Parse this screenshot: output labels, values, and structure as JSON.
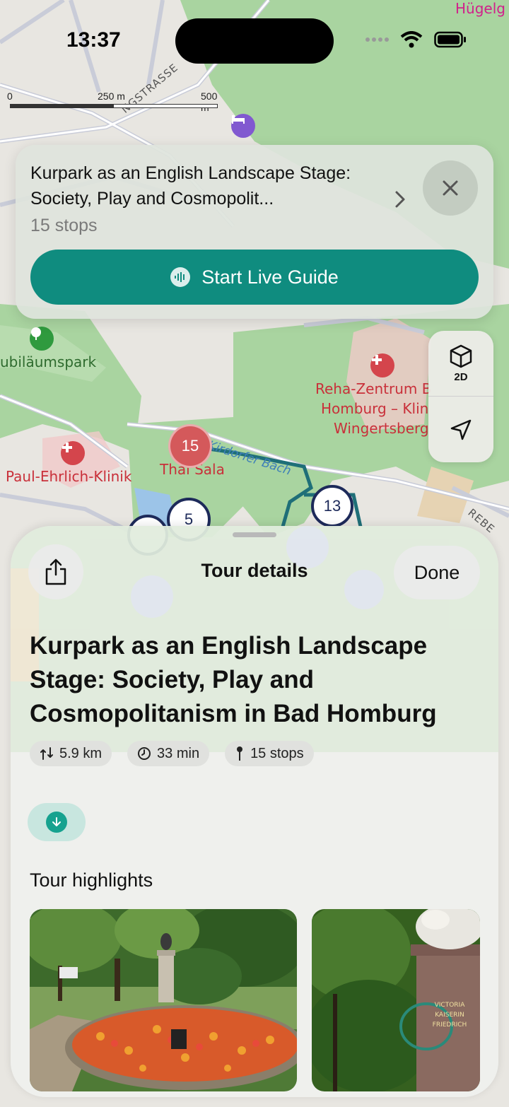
{
  "status_bar": {
    "time": "13:37"
  },
  "scale_bar": {
    "labels": [
      "0",
      "250 m",
      "500 m"
    ]
  },
  "map": {
    "labels": {
      "park": "ubiläumspark",
      "clinic": "Paul-Ehrlich-Klinik",
      "rehab_lines": [
        "Reha-Zentrum B",
        "Homburg – Klin",
        "Wingertsberg"
      ],
      "thai_sala": "Thai Sala",
      "brook": "Kirdorfer Bach",
      "street": "NGSTRASSE",
      "street_right": "REBE",
      "top_right": "Hügelg"
    },
    "markers": [
      {
        "number": "15",
        "style": "visited"
      },
      {
        "number": "13",
        "style": "default"
      },
      {
        "number": "5",
        "style": "default"
      }
    ],
    "controls": {
      "view_mode": "2D"
    }
  },
  "tour_card": {
    "title": "Kurpark as an English Landscape Stage: Society, Play and Cosmopolit...",
    "stops": "15 stops",
    "live_guide_label": "Start Live Guide"
  },
  "sheet": {
    "title": "Tour details",
    "done_label": "Done",
    "tour_title": "Kurpark as an English Landscape Stage: Society, Play and Cosmopolitanism in Bad Homburg",
    "chips": {
      "distance": "5.9 km",
      "duration": "33 min",
      "stops": "15 stops"
    },
    "highlights_heading": "Tour highlights",
    "highlight_images": [
      {
        "alt": "Monument bust with flowerbed in park",
        "icon": "photo"
      },
      {
        "alt": "Victoria Kaiserin Friedrich statue pedestal",
        "icon": "photo",
        "inscription": [
          "VICTORIA",
          "KAISERIN",
          "FRIEDRICH"
        ]
      }
    ]
  },
  "colors": {
    "accent": "#0f8c7f",
    "marker_visited": "#d4595b",
    "marker_default": "#1d2a5a",
    "park_green": "#a9d4a0"
  }
}
